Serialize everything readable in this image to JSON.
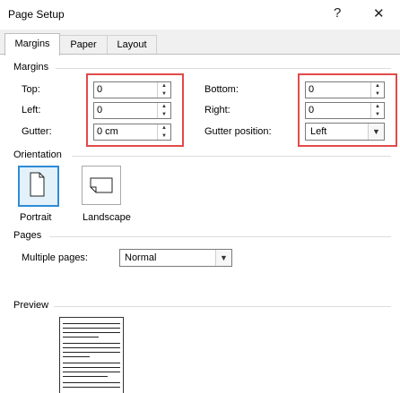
{
  "window": {
    "title": "Page Setup",
    "help_glyph": "?",
    "close_glyph": "✕"
  },
  "tabs": [
    {
      "label": "Margins",
      "active": true
    },
    {
      "label": "Paper",
      "active": false
    },
    {
      "label": "Layout",
      "active": false
    }
  ],
  "margins": {
    "section": "Margins",
    "top_label": "Top:",
    "top_value": "0",
    "left_label": "Left:",
    "left_value": "0",
    "gutter_label": "Gutter:",
    "gutter_value": "0 cm",
    "bottom_label": "Bottom:",
    "bottom_value": "0",
    "right_label": "Right:",
    "right_value": "0",
    "gutter_position_label": "Gutter position:",
    "gutter_position_value": "Left"
  },
  "orientation": {
    "section": "Orientation",
    "portrait": "Portrait",
    "landscape": "Landscape",
    "selected": "portrait"
  },
  "pages": {
    "section": "Pages",
    "multiple_label": "Multiple pages:",
    "multiple_value": "Normal"
  },
  "preview": {
    "section": "Preview"
  },
  "colors": {
    "highlight": "#e24a4a",
    "selection": "#2e8bd6"
  },
  "icons": [
    "help-icon",
    "close-icon",
    "spin-up-icon",
    "spin-down-icon",
    "dropdown-arrow-icon",
    "portrait-page-icon",
    "landscape-page-icon"
  ]
}
